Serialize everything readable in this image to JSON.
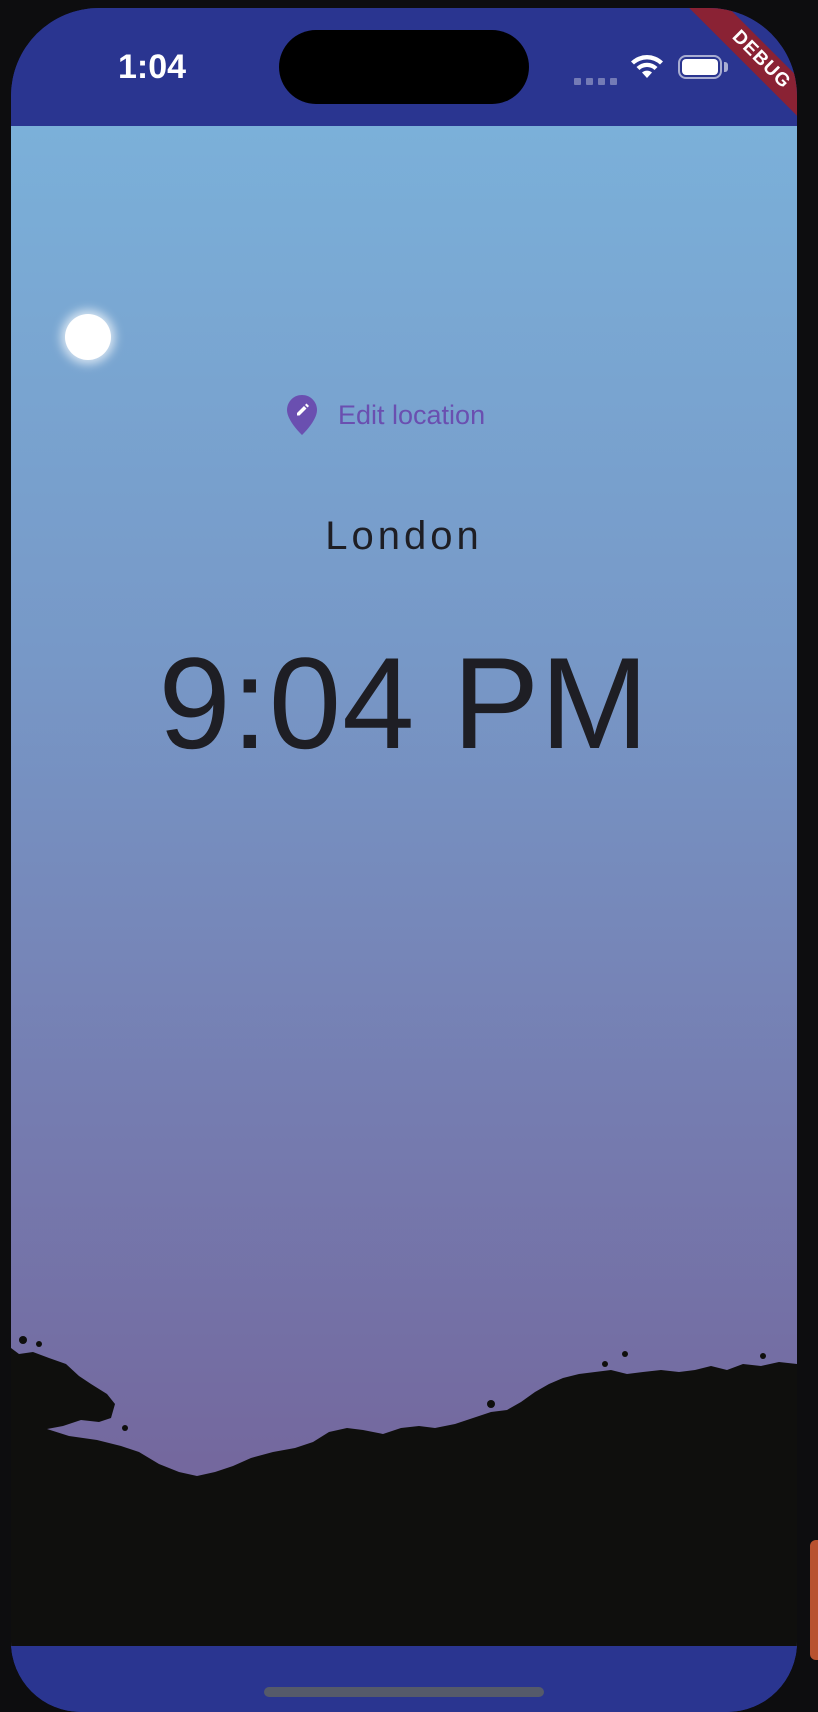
{
  "status_bar": {
    "time": "1:04",
    "signal_icon": "cellular-dots-icon",
    "wifi_icon": "wifi-icon",
    "battery_icon": "battery-icon"
  },
  "debug_banner": {
    "label": "DEBUG",
    "color": "#8a2234"
  },
  "location_button": {
    "icon": "location-pin-edit-icon",
    "label": "Edit location"
  },
  "location": {
    "city": "London",
    "time": "9:04 PM"
  },
  "scene": {
    "celestial_body": "moon",
    "sky_top_color": "#7bb0d9",
    "sky_bottom_color": "#746398",
    "silhouette_color": "#0f0f0d"
  },
  "colors": {
    "system_bar": "#2a3590",
    "accent": "#6a4fb0",
    "text": "#1e1e24"
  }
}
